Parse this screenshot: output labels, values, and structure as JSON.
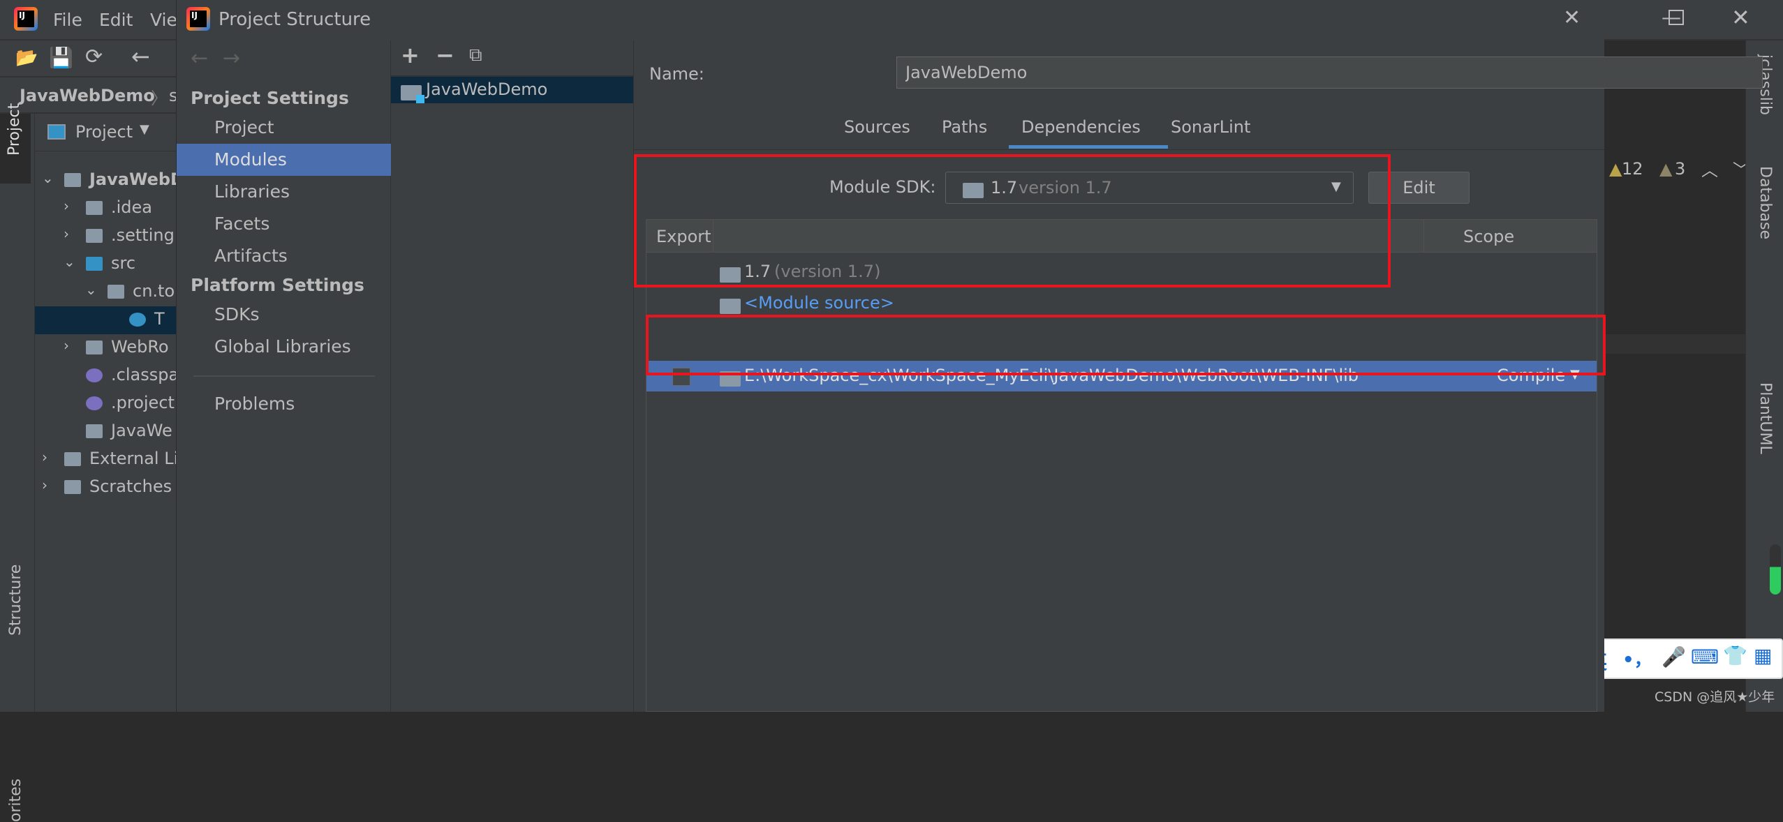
{
  "ide": {
    "menu": [
      "File",
      "Edit",
      "View"
    ],
    "breadcrumb": "JavaWebDemo",
    "breadcrumb_next": "s",
    "left_strip": {
      "project": "Project",
      "structure": "Structure",
      "favorites": "orites"
    },
    "project_view": "Project",
    "tree": [
      {
        "label": "JavaWebD",
        "indent": 0,
        "arrow": "v",
        "icon": "module"
      },
      {
        "label": ".idea",
        "indent": 1,
        "arrow": ">",
        "icon": "folder"
      },
      {
        "label": ".setting",
        "indent": 1,
        "arrow": ">",
        "icon": "folder"
      },
      {
        "label": "src",
        "indent": 1,
        "arrow": "v",
        "icon": "src"
      },
      {
        "label": "cn.to",
        "indent": 2,
        "arrow": "v",
        "icon": "package"
      },
      {
        "label": "T",
        "indent": 3,
        "arrow": "",
        "icon": "class"
      },
      {
        "label": "WebRo",
        "indent": 1,
        "arrow": ">",
        "icon": "folder"
      },
      {
        "label": ".classpa",
        "indent": 1,
        "arrow": "",
        "icon": "eclipse"
      },
      {
        "label": ".project",
        "indent": 1,
        "arrow": "",
        "icon": "eclipse"
      },
      {
        "label": "JavaWe",
        "indent": 1,
        "arrow": "",
        "icon": "file"
      },
      {
        "label": "External Li",
        "indent": 0,
        "arrow": ">",
        "icon": "library"
      },
      {
        "label": "Scratches",
        "indent": 0,
        "arrow": ">",
        "icon": "scratch"
      }
    ],
    "inspections": {
      "warnings": "12",
      "weak": "3"
    },
    "right_strip": [
      "jclasslib",
      "Database",
      "PlantUML"
    ],
    "ime": {
      "lang": "英",
      "punct": "•，"
    },
    "watermark": "CSDN @追风★少年"
  },
  "dialog": {
    "title": "Project Structure",
    "nav": {
      "project_settings": "Project Settings",
      "items1": [
        "Project",
        "Modules",
        "Libraries",
        "Facets",
        "Artifacts"
      ],
      "platform_settings": "Platform Settings",
      "items2": [
        "SDKs",
        "Global Libraries"
      ],
      "problems": "Problems",
      "selected": "Modules"
    },
    "modules": [
      "JavaWebDemo"
    ],
    "name_label": "Name:",
    "name_value": "JavaWebDemo",
    "tabs": [
      "Sources",
      "Paths",
      "Dependencies",
      "SonarLint"
    ],
    "active_tab": "Dependencies",
    "sdk_label": "Module SDK:",
    "sdk_value": "1.7",
    "sdk_version": "version 1.7",
    "edit_label": "Edit",
    "table": {
      "col_export": "Export",
      "col_scope": "Scope",
      "rows": [
        {
          "name": "1.7",
          "extra": "(version 1.7)",
          "type": "sdk"
        },
        {
          "name": "<Module source>",
          "type": "source"
        },
        {
          "name": "E:\\WorkSpace_cx\\WorkSpace_MyEcli\\JavaWebDemo\\WebRoot\\WEB-INF\\lib",
          "scope": "Compile",
          "type": "lib",
          "checked": false,
          "selected": true
        }
      ]
    },
    "colors": {
      "highlight": "#4b6eaf",
      "selection_dark": "#0d293e",
      "annotation_red": "#e8141e",
      "link": "#589df6"
    }
  }
}
